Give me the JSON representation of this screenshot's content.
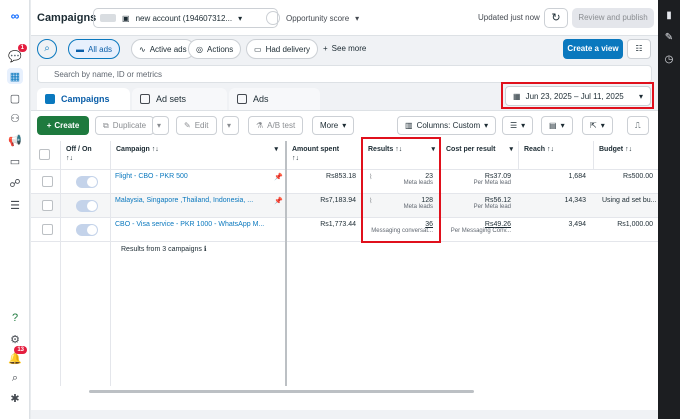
{
  "leftnav": {
    "notif_badge": "1",
    "alerts_badge": "13"
  },
  "topbar": {
    "title": "Campaigns",
    "account_name": "new account (194607312...",
    "opportunity_label": "Opportunity score",
    "updated_text": "Updated just now",
    "review_label": "Review and publish"
  },
  "filters": {
    "all_ads": "All ads",
    "active_ads": "Active ads",
    "actions": "Actions",
    "had_delivery": "Had delivery",
    "see_more": "See more",
    "create_view": "Create a view"
  },
  "search": {
    "placeholder": "Search by name, ID or metrics"
  },
  "tabs": {
    "campaigns": "Campaigns",
    "ad_sets": "Ad sets",
    "ads": "Ads"
  },
  "date_range": "Jun 23, 2025 – Jul 11, 2025",
  "actions_bar": {
    "create": "Create",
    "duplicate": "Duplicate",
    "edit": "Edit",
    "ab_test": "A/B test",
    "more": "More",
    "columns": "Columns: Custom"
  },
  "columns": {
    "off_on": "Off / On",
    "campaign": "Campaign",
    "amount_spent": "Amount spent",
    "results": "Results",
    "cost_per_result": "Cost per result",
    "reach": "Reach",
    "budget": "Budget"
  },
  "rows": [
    {
      "campaign": "Flight - CBO - PKR 500",
      "amount": "Rs853.18",
      "results": "23",
      "results_sub": "Meta leads",
      "cost": "Rs37.09",
      "cost_sub": "Per Meta lead",
      "reach": "1,684",
      "budget": "Rs500.00"
    },
    {
      "campaign": "Malaysia, Singapore ,Thailand, Indonesia, ...",
      "amount": "Rs7,183.94",
      "results": "128",
      "results_sub": "Meta leads",
      "cost": "Rs56.12",
      "cost_sub": "Per Meta lead",
      "reach": "14,343",
      "budget": "Using ad set bu..."
    },
    {
      "campaign": "CBO - Visa service - PKR 1000 - WhatsApp M...",
      "amount": "Rs1,773.44",
      "results": "36",
      "results_sub": "Messaging conversat...",
      "cost": "Rs49.26",
      "cost_sub": "Per Messaging Conv...",
      "reach": "3,494",
      "budget": "Rs1,000.00"
    }
  ],
  "footer_text": "Results from 3 campaigns"
}
